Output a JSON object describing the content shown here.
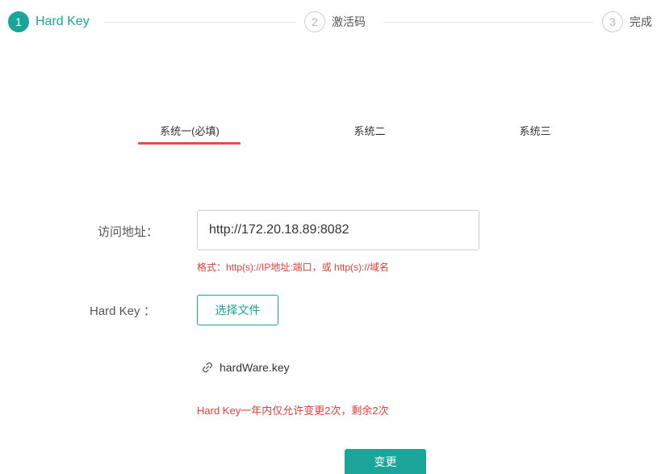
{
  "stepper": {
    "steps": [
      {
        "number": "1",
        "label": "Hard Key"
      },
      {
        "number": "2",
        "label": "激活码"
      },
      {
        "number": "3",
        "label": "完成"
      }
    ]
  },
  "tabs": [
    {
      "label": "系统一(必填)"
    },
    {
      "label": "系统二"
    },
    {
      "label": "系统三"
    }
  ],
  "form": {
    "address_label": "访问地址：",
    "address_value": "http://172.20.18.89:8082",
    "address_hint": "格式：http(s)://IP地址:端口，或 http(s)://域名",
    "hardkey_label": "Hard Key  ：",
    "choose_file_label": "选择文件",
    "file_name": "hardWare.key",
    "change_limit_text": "Hard Key一年内仅允许变更2次，剩余2次",
    "submit_label": "变更"
  },
  "colors": {
    "accent": "#1ba59a",
    "error": "#e0403a",
    "tab_underline": "#d9534f"
  },
  "icons": {
    "file": "link-icon"
  }
}
